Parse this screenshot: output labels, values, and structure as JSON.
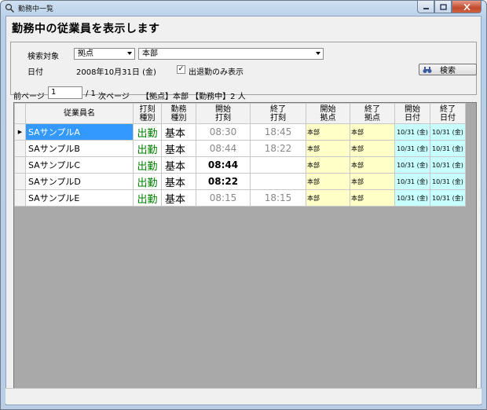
{
  "window": {
    "title": "勤務中一覧"
  },
  "header": {
    "title": "勤務中の従業員を表示します"
  },
  "search": {
    "target_label": "検索対象",
    "target_type": "拠点",
    "target_value": "本部",
    "date_label": "日付",
    "date_value": "2008年10月31日 (金)",
    "checkbox_checked": true,
    "checkbox_label": "出退勤のみ表示",
    "button_label": "検索"
  },
  "pager": {
    "prev_label": "前ページ",
    "current_page": "1",
    "total_pages": "/  1",
    "next_label": "次ページ",
    "summary": "【拠点】本部 【勤務中】2 人"
  },
  "grid": {
    "columns": [
      "従業員名",
      "打刻\n種別",
      "勤務\n種別",
      "開始\n打刻",
      "終了\n打刻",
      "開始\n拠点",
      "終了\n拠点",
      "開始\n日付",
      "終了\n日付"
    ],
    "rows": [
      {
        "name": "SAサンプルA",
        "punch_kind": "出勤",
        "work_kind": "基本",
        "start": "08:30",
        "end": "18:45",
        "start_base": "本部",
        "end_base": "本部",
        "start_date": "10/31 (金)",
        "end_date": "10/31 (金)",
        "start_bold": false,
        "selected": true
      },
      {
        "name": "SAサンプルB",
        "punch_kind": "出勤",
        "work_kind": "基本",
        "start": "08:44",
        "end": "18:22",
        "start_base": "本部",
        "end_base": "本部",
        "start_date": "10/31 (金)",
        "end_date": "10/31 (金)",
        "start_bold": false,
        "selected": false
      },
      {
        "name": "SAサンプルC",
        "punch_kind": "出勤",
        "work_kind": "基本",
        "start": "08:44",
        "end": "",
        "start_base": "本部",
        "end_base": "本部",
        "start_date": "10/31 (金)",
        "end_date": "10/31 (金)",
        "start_bold": true,
        "selected": false
      },
      {
        "name": "SAサンプルD",
        "punch_kind": "出勤",
        "work_kind": "基本",
        "start": "08:22",
        "end": "",
        "start_base": "本部",
        "end_base": "本部",
        "start_date": "10/31 (金)",
        "end_date": "10/31 (金)",
        "start_bold": true,
        "selected": false
      },
      {
        "name": "SAサンプルE",
        "punch_kind": "出勤",
        "work_kind": "基本",
        "start": "08:15",
        "end": "18:15",
        "start_base": "本部",
        "end_base": "本部",
        "start_date": "10/31 (金)",
        "end_date": "10/31 (金)",
        "start_bold": false,
        "selected": false
      }
    ]
  }
}
